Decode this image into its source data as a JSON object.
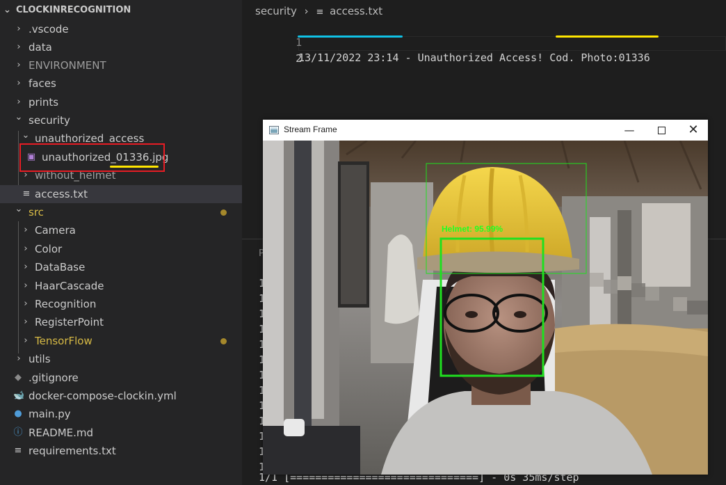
{
  "explorer": {
    "root": "CLOCKINRECOGNITION",
    "items": [
      {
        "label": ".vscode",
        "type": "folder"
      },
      {
        "label": "data",
        "type": "folder"
      },
      {
        "label": "ENVIRONMENT",
        "type": "folder"
      },
      {
        "label": "faces",
        "type": "folder"
      },
      {
        "label": "prints",
        "type": "folder"
      },
      {
        "label": "security",
        "type": "folder-open"
      },
      {
        "label": "unauthorized_access",
        "type": "folder-open"
      },
      {
        "label": "unauthorized_01336.jpg",
        "type": "image-file"
      },
      {
        "label": "without_helmet",
        "type": "folder"
      },
      {
        "label": "access.txt",
        "type": "text-file"
      },
      {
        "label": "src",
        "type": "folder-open"
      },
      {
        "label": "Camera",
        "type": "folder"
      },
      {
        "label": "Color",
        "type": "folder"
      },
      {
        "label": "DataBase",
        "type": "folder"
      },
      {
        "label": "HaarCascade",
        "type": "folder"
      },
      {
        "label": "Recognition",
        "type": "folder"
      },
      {
        "label": "RegisterPoint",
        "type": "folder"
      },
      {
        "label": "TensorFlow",
        "type": "folder"
      },
      {
        "label": "utils",
        "type": "folder"
      },
      {
        "label": ".gitignore",
        "type": "git-file"
      },
      {
        "label": "docker-compose-clockin.yml",
        "type": "docker-file"
      },
      {
        "label": "main.py",
        "type": "python-file"
      },
      {
        "label": "README.md",
        "type": "info-file"
      },
      {
        "label": "requirements.txt",
        "type": "text-file"
      }
    ]
  },
  "editor": {
    "breadcrumb": {
      "folder": "security",
      "file": "access.txt"
    },
    "lines": [
      {
        "number": "1",
        "text": "13/11/2022 23:14 - Unauthorized Access! Cod. Photo:01336"
      },
      {
        "number": "2",
        "text": ""
      }
    ]
  },
  "terminal": {
    "tab_letter": "P",
    "line_prefix": "1",
    "last_line": "1/1 [==============================] - 0s 35ms/step"
  },
  "stream_window": {
    "title": "Stream Frame",
    "detection_label": "Helmet: 95.99%",
    "colors": {
      "box": "#1fe01f",
      "label": "#22ff22"
    }
  },
  "colors": {
    "highlight_box": "#e81c24",
    "underline_yellow": "#ffe600",
    "underline_cyan": "#10c2e6",
    "modified_dot": "#a5882b",
    "modified_text": "#d7ba45"
  }
}
